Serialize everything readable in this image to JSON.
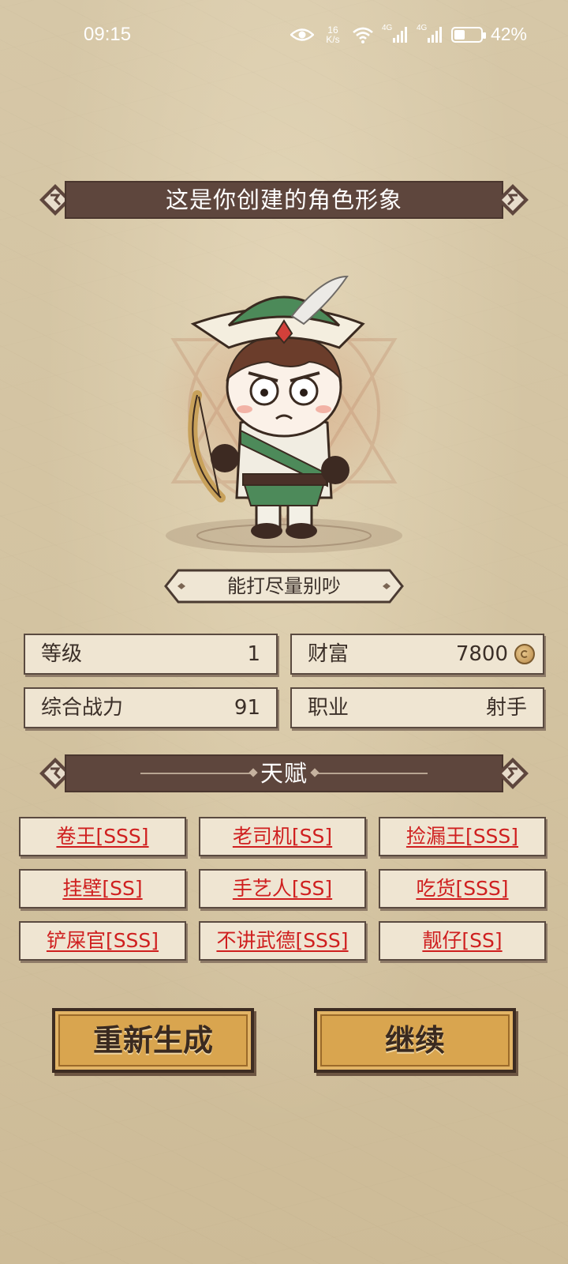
{
  "status_bar": {
    "time": "09:15",
    "net_speed_value": "16",
    "net_speed_unit": "K/s",
    "signal1": "4G",
    "signal2": "4G",
    "battery_percent": "42%",
    "battery_level": 0.42,
    "icons": [
      "eye-icon",
      "wifi-icon",
      "signal-icon",
      "signal-icon",
      "battery-icon"
    ]
  },
  "header": {
    "title": "这是你创建的角色形象"
  },
  "character": {
    "name": "能打尽量别吵"
  },
  "stats": {
    "level_label": "等级",
    "level_value": "1",
    "wealth_label": "财富",
    "wealth_value": "7800",
    "power_label": "综合战力",
    "power_value": "91",
    "class_label": "职业",
    "class_value": "射手"
  },
  "talents": {
    "title": "天赋",
    "items": [
      "卷王[SSS]",
      "老司机[SS]",
      "捡漏王[SSS]",
      "挂壁[SS]",
      "手艺人[SS]",
      "吃货[SSS]",
      "铲屎官[SSS]",
      "不讲武德[SSS]",
      "靓仔[SS]"
    ]
  },
  "buttons": {
    "regenerate": "重新生成",
    "continue": "继续"
  },
  "colors": {
    "banner": "#5e463d",
    "talent_text": "#cf1f1f",
    "button": "#d9a54f",
    "panel": "#efe5d2"
  }
}
